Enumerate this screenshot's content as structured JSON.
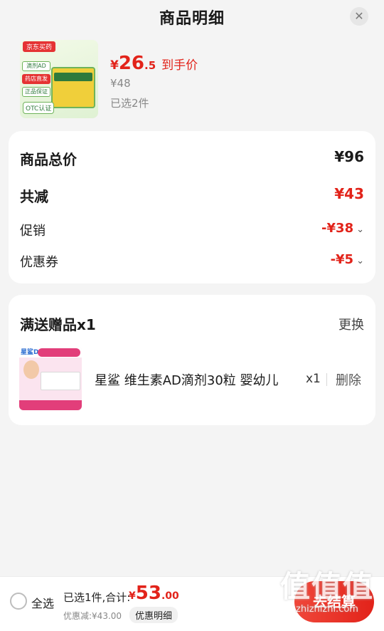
{
  "header": {
    "title": "商品明细",
    "close_glyph": "✕"
  },
  "product": {
    "thumb_tag": "京东买药",
    "thumb_chips": [
      "滴剂AD",
      "药店直发",
      "正品保证"
    ],
    "thumb_otc": "OTC认证",
    "price_symbol": "¥",
    "price_int": "26",
    "price_dec": ".5",
    "price_label": "到手价",
    "original_price": "¥48",
    "selected": "已选2件"
  },
  "summary": {
    "total_label": "商品总价",
    "total_value": "¥96",
    "reduce_label": "共减",
    "reduce_value": "¥43",
    "promo_label": "促销",
    "promo_value": "-¥38",
    "coupon_label": "优惠券",
    "coupon_value": "-¥5",
    "chevron": "⌄"
  },
  "gift": {
    "heading": "满送赠品x1",
    "swap": "更换",
    "thumb_brand": "星鲨D",
    "title": "星鲨 维生素AD滴剂30粒 婴幼儿",
    "qty": "x1",
    "delete": "删除"
  },
  "footer": {
    "select_all": "全选",
    "selected_info": "已选1件,合计:",
    "total_symbol": "¥",
    "total_int": "53",
    "total_dec": ".00",
    "discount": "优惠减:¥43.00",
    "detail": "优惠明细",
    "checkout": "去结算",
    "watermark_word": "值值值",
    "watermark_url": "zhizhizhi.com"
  },
  "colors": {
    "accent": "#e2231a",
    "background": "#f4f4f4",
    "card": "#ffffff"
  }
}
